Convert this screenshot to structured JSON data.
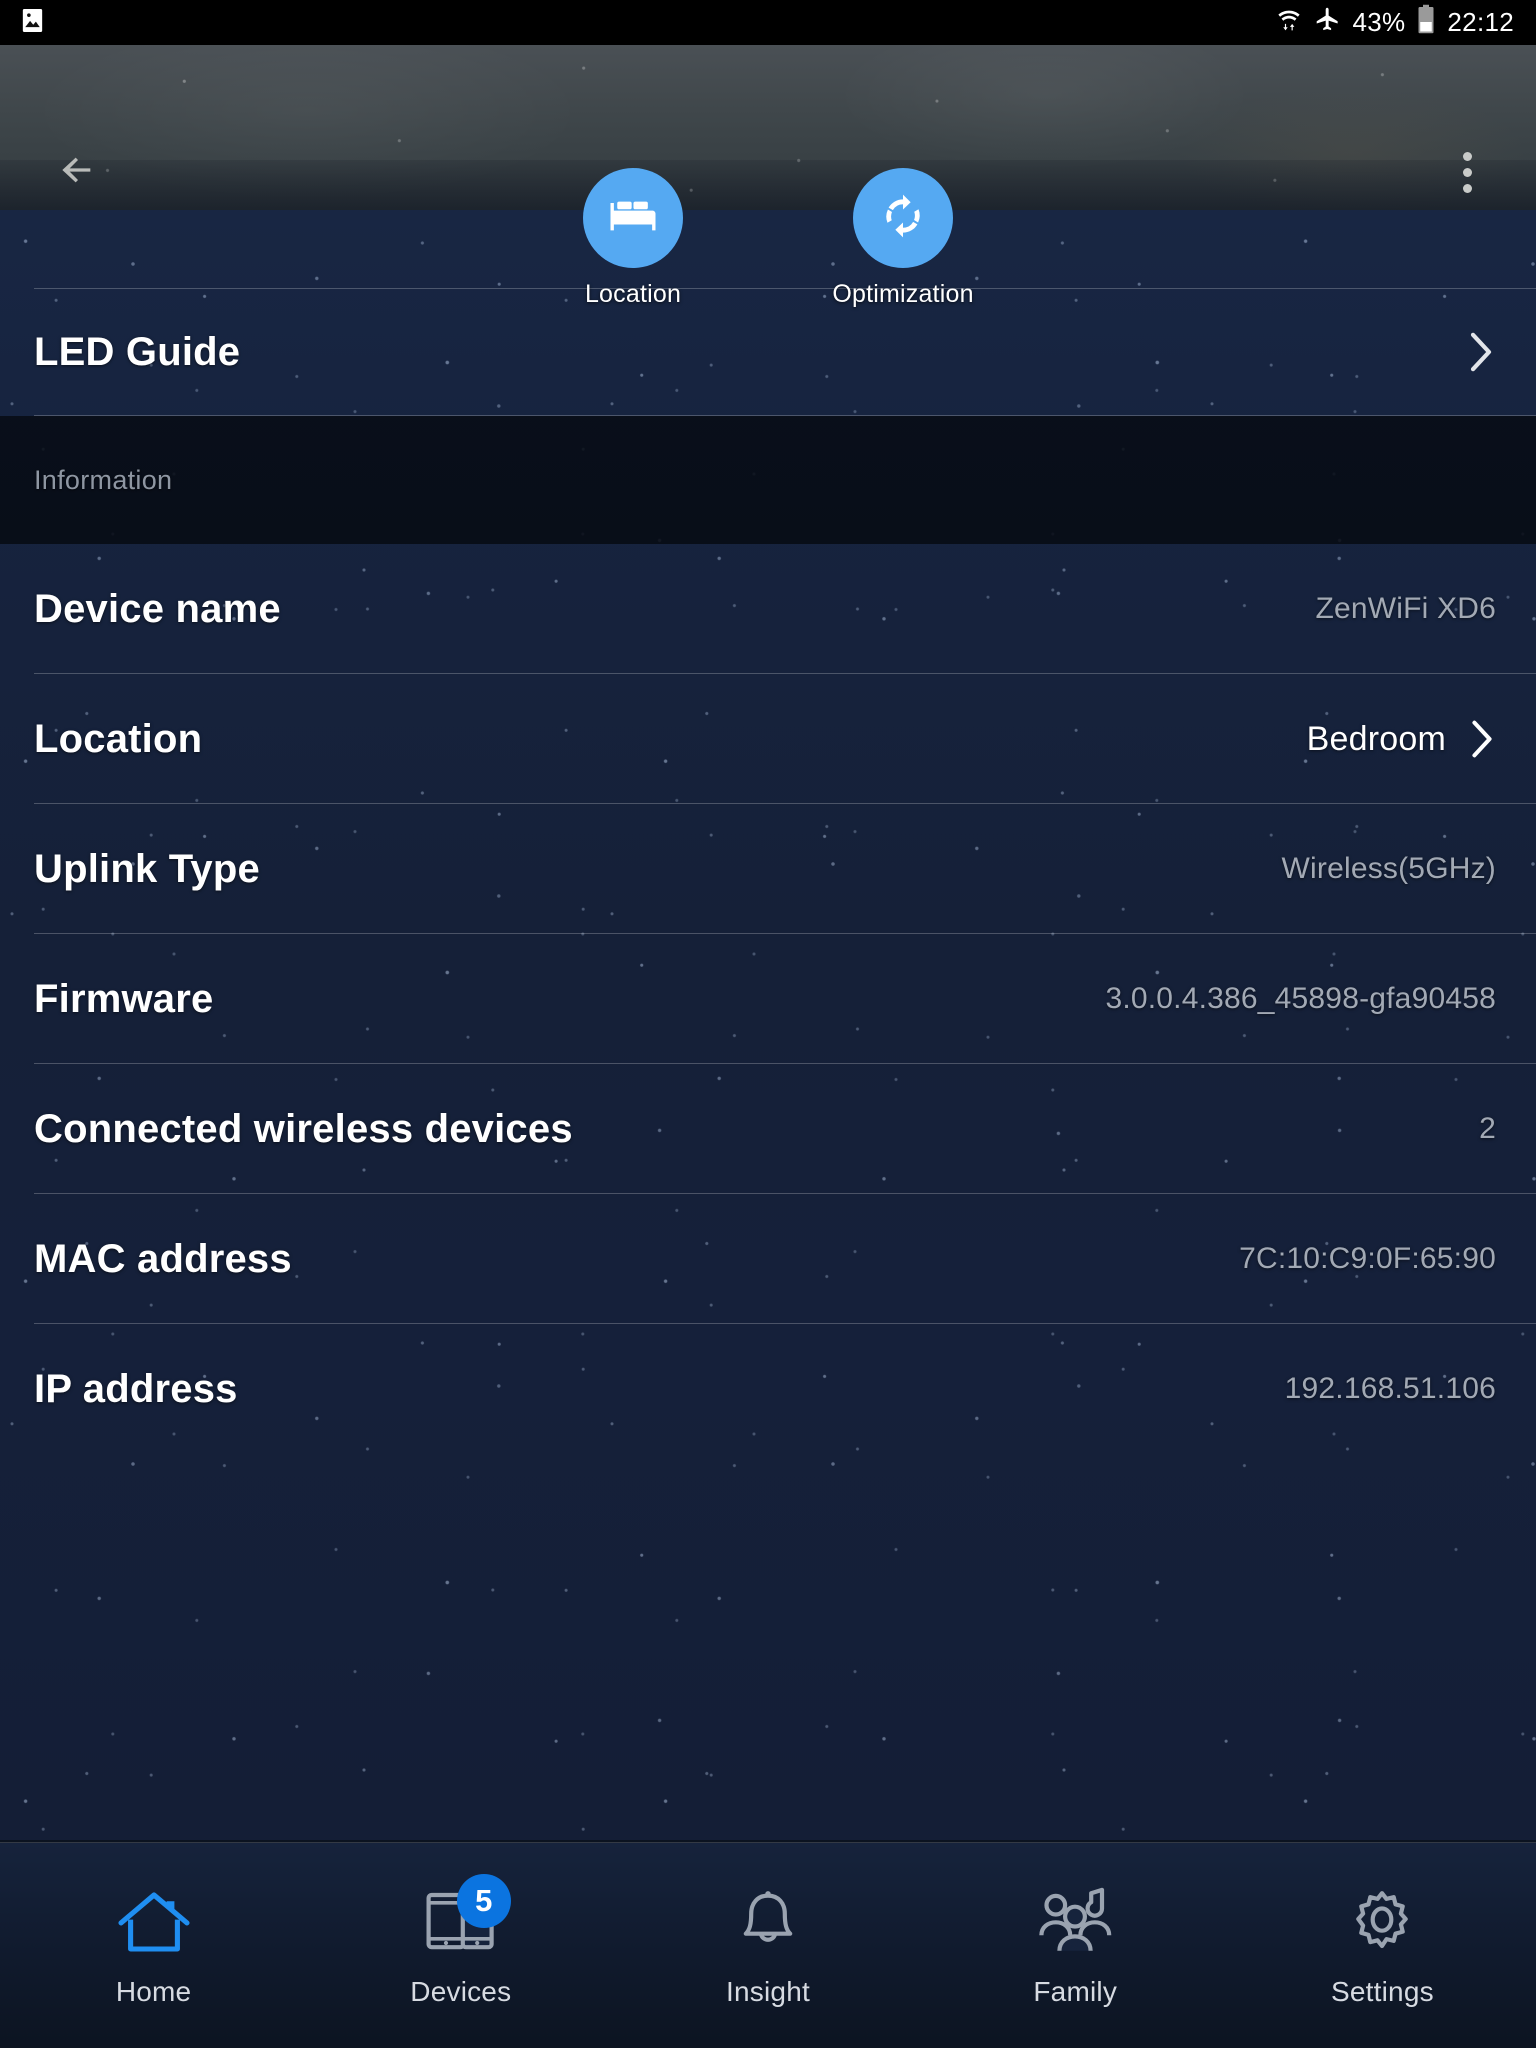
{
  "status_bar": {
    "left_icon": "screenshot-image-icon",
    "wifi_icon": "wifi-transfer-icon",
    "airplane_icon": "airplane-mode-icon",
    "battery_percent": "43%",
    "battery_icon": "battery-icon",
    "time": "22:12"
  },
  "header": {
    "back_icon": "back-arrow-icon",
    "overflow_icon": "overflow-menu-icon",
    "actions": [
      {
        "label": "Location",
        "icon": "bed-icon"
      },
      {
        "label": "Optimization",
        "icon": "refresh-sync-icon"
      }
    ]
  },
  "list": {
    "led_guide": {
      "label": "LED Guide",
      "chevron": "chevron-right-icon"
    },
    "section_title": "Information",
    "rows": [
      {
        "label": "Device name",
        "value": "ZenWiFi XD6",
        "chevron": false,
        "bright": false
      },
      {
        "label": "Location",
        "value": "Bedroom",
        "chevron": true,
        "bright": true
      },
      {
        "label": "Uplink Type",
        "value": "Wireless(5GHz)",
        "chevron": false,
        "bright": false
      },
      {
        "label": "Firmware",
        "value": "3.0.0.4.386_45898-gfa90458",
        "chevron": false,
        "bright": false
      },
      {
        "label": "Connected wireless devices",
        "value": "2",
        "chevron": false,
        "bright": false
      },
      {
        "label": "MAC address",
        "value": "7C:10:C9:0F:65:90",
        "chevron": false,
        "bright": false
      },
      {
        "label": "IP address",
        "value": "192.168.51.106",
        "chevron": false,
        "bright": false
      }
    ]
  },
  "bottom_nav": {
    "items": [
      {
        "label": "Home",
        "icon": "home-icon",
        "active": true,
        "badge": ""
      },
      {
        "label": "Devices",
        "icon": "devices-icon",
        "active": false,
        "badge": "5"
      },
      {
        "label": "Insight",
        "icon": "bell-icon",
        "active": false,
        "badge": ""
      },
      {
        "label": "Family",
        "icon": "family-icon",
        "active": false,
        "badge": ""
      },
      {
        "label": "Settings",
        "icon": "gear-icon",
        "active": false,
        "badge": ""
      }
    ]
  },
  "colors": {
    "accent_blue": "#55a9f2",
    "nav_active": "#1f8ef1",
    "badge_blue": "#0b74e0",
    "bg_navy": "#15203a",
    "value_grey": "#a2a9b4"
  }
}
